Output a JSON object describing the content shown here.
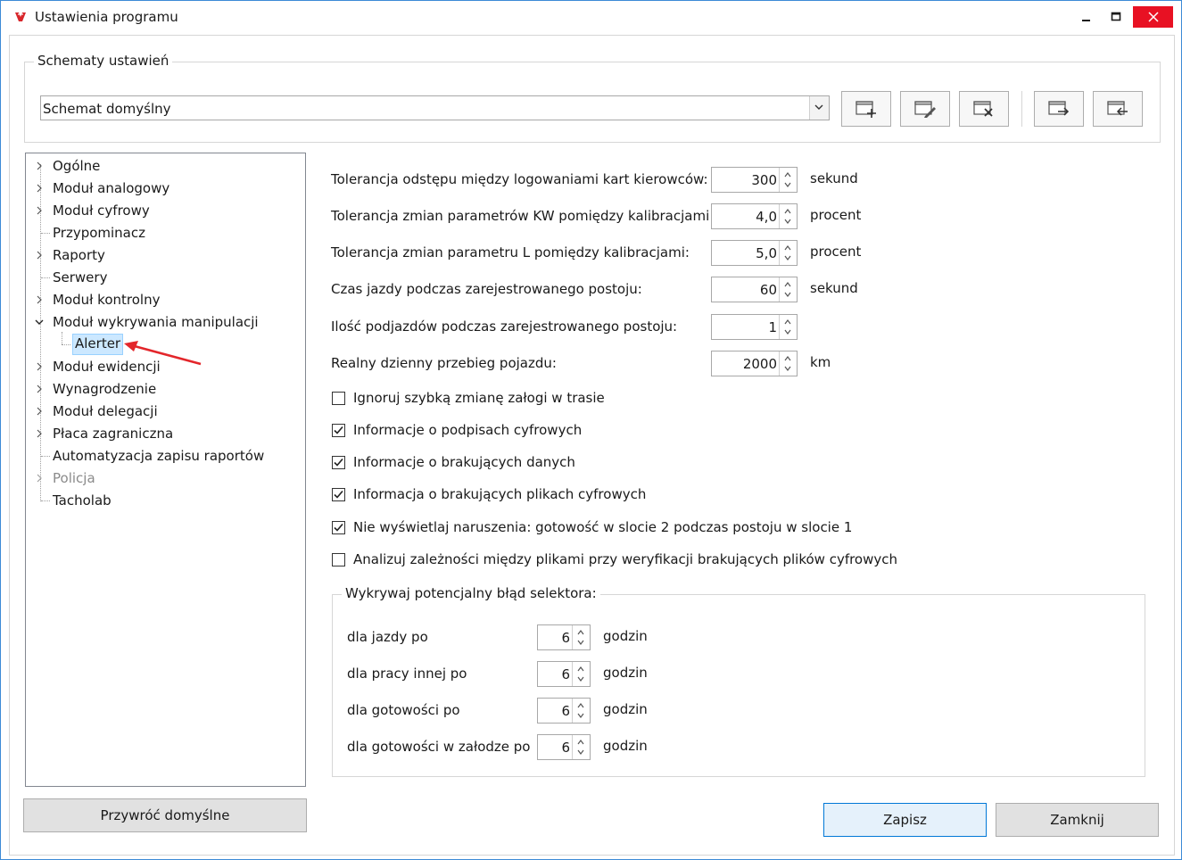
{
  "window": {
    "title": "Ustawienia programu",
    "icon": "app-logo-icon"
  },
  "schemes": {
    "legend": "Schematy ustawień",
    "selected": "Schemat domyślny",
    "toolbar_icons": [
      "new-scheme-icon",
      "edit-scheme-icon",
      "delete-scheme-icon",
      "export-scheme-icon",
      "import-scheme-icon"
    ]
  },
  "tree": {
    "items": [
      {
        "label": "Ogólne",
        "expandable": true
      },
      {
        "label": "Moduł analogowy",
        "expandable": true
      },
      {
        "label": "Moduł cyfrowy",
        "expandable": true
      },
      {
        "label": "Przypominacz",
        "expandable": false
      },
      {
        "label": "Raporty",
        "expandable": true
      },
      {
        "label": "Serwery",
        "expandable": false
      },
      {
        "label": "Moduł kontrolny",
        "expandable": true
      },
      {
        "label": "Moduł wykrywania manipulacji",
        "expandable": true,
        "expanded": true
      },
      {
        "label": "Alerter",
        "selected": true
      },
      {
        "label": "Moduł ewidencji",
        "expandable": true
      },
      {
        "label": "Wynagrodzenie",
        "expandable": true
      },
      {
        "label": "Moduł delegacji",
        "expandable": true
      },
      {
        "label": "Płaca zagraniczna",
        "expandable": true
      },
      {
        "label": "Automatyzacja zapisu raportów",
        "expandable": false
      },
      {
        "label": "Policja",
        "expandable": true,
        "disabled": true
      },
      {
        "label": "Tacholab",
        "expandable": false
      }
    ]
  },
  "settings": {
    "fields": [
      {
        "label": "Tolerancja odstępu między logowaniami kart kierowców:",
        "value": "300",
        "unit": "sekund"
      },
      {
        "label": "Tolerancja zmian parametrów KW pomiędzy kalibracjami:",
        "value": "4,0",
        "unit": "procent"
      },
      {
        "label": "Tolerancja zmian parametru L pomiędzy kalibracjami:",
        "value": "5,0",
        "unit": "procent"
      },
      {
        "label": "Czas jazdy podczas zarejestrowanego postoju:",
        "value": "60",
        "unit": "sekund"
      },
      {
        "label": "Ilość podjazdów podczas zarejestrowanego postoju:",
        "value": "1",
        "unit": ""
      },
      {
        "label": "Realny dzienny przebieg pojazdu:",
        "value": "2000",
        "unit": "km"
      }
    ],
    "checkboxes": [
      {
        "label": "Ignoruj szybką zmianę załogi w trasie",
        "checked": false
      },
      {
        "label": "Informacje o podpisach cyfrowych",
        "checked": true
      },
      {
        "label": "Informacje o brakujących danych",
        "checked": true
      },
      {
        "label": "Informacja o brakujących plikach cyfrowych",
        "checked": true
      },
      {
        "label": "Nie wyświetlaj naruszenia: gotowość w slocie 2 podczas postoju w slocie 1",
        "checked": true
      },
      {
        "label": "Analizuj zależności między plikami przy weryfikacji brakujących plików cyfrowych",
        "checked": false
      }
    ],
    "selector": {
      "legend": "Wykrywaj potencjalny błąd selektora:",
      "rows": [
        {
          "label": "dla jazdy po",
          "value": "6",
          "unit": "godzin"
        },
        {
          "label": "dla pracy innej po",
          "value": "6",
          "unit": "godzin"
        },
        {
          "label": "dla gotowości po",
          "value": "6",
          "unit": "godzin"
        },
        {
          "label": "dla gotowości w załodze po",
          "value": "6",
          "unit": "godzin"
        }
      ]
    }
  },
  "buttons": {
    "restore": "Przywróć domyślne",
    "save": "Zapisz",
    "close": "Zamknij"
  },
  "colors": {
    "accent": "#0078d7",
    "close_button": "#e81123",
    "selection": "#cce8ff",
    "annotation_arrow": "#e3262b"
  }
}
